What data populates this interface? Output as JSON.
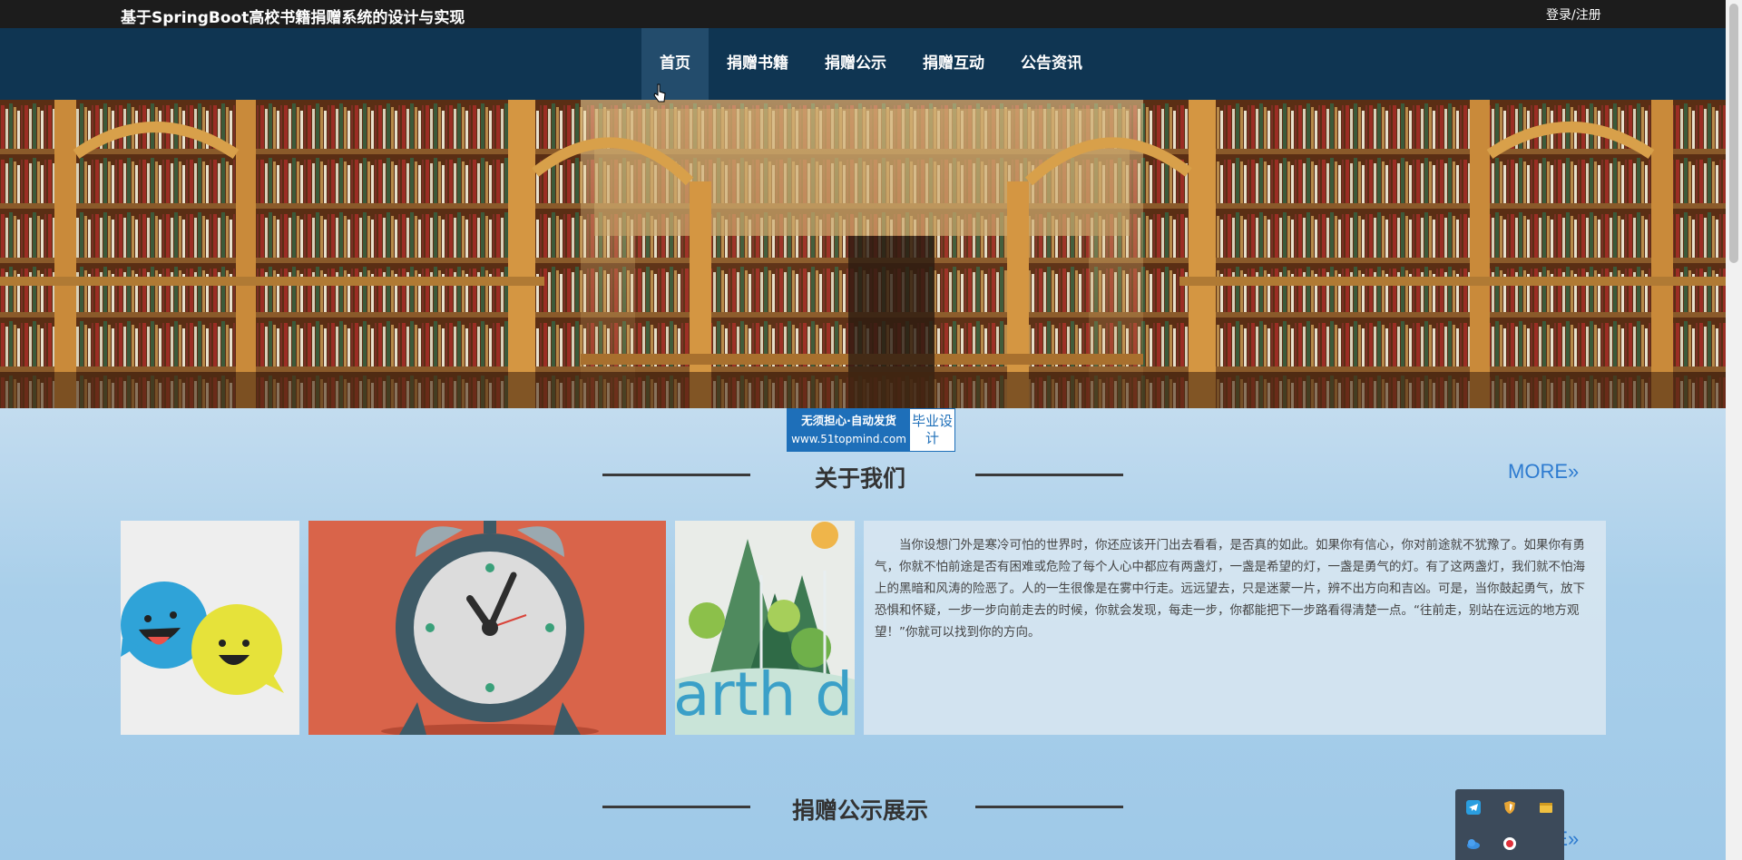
{
  "header": {
    "site_title": "基于SpringBoot高校书籍捐赠系统的设计与实现",
    "login_label": "登录/注册"
  },
  "nav": {
    "items": [
      {
        "label": "首页"
      },
      {
        "label": "捐赠书籍"
      },
      {
        "label": "捐赠公示"
      },
      {
        "label": "捐赠互动"
      },
      {
        "label": "公告资讯"
      }
    ],
    "active_index": 0
  },
  "watermark": {
    "line1": "无须担心·自动发货",
    "line2": "www.51topmind.com",
    "side": "毕业设计"
  },
  "about": {
    "title": "关于我们",
    "more_label": "MORE»",
    "text": "当你设想门外是寒冷可怕的世界时，你还应该开门出去看看，是否真的如此。如果你有信心，你对前途就不犹豫了。如果你有勇气，你就不怕前途是否有困难或危险了每个人心中都应有两盏灯，一盏是希望的灯，一盏是勇气的灯。有了这两盏灯，我们就不怕海上的黑暗和风涛的险恶了。人的一生很像是在雾中行走。远远望去，只是迷蒙一片，辨不出方向和吉凶。可是，当你鼓起勇气，放下恐惧和怀疑，一步一步向前走去的时候，你就会发现，每走一步，你都能把下一步路看得清楚一点。“往前走，别站在远远的地方观望！”你就可以找到你的方向。",
    "images": [
      {
        "name": "chat-bubbles-illustration"
      },
      {
        "name": "alarm-clock-illustration"
      },
      {
        "name": "earth-day-illustration",
        "text": "arth da"
      }
    ]
  },
  "donation": {
    "title": "捐赠公示展示",
    "more_label": "MORE»"
  },
  "tray": {
    "icons": [
      "telegram-icon",
      "shield-icon",
      "window-icon",
      "cloud-icon",
      "record-icon"
    ]
  },
  "colors": {
    "topbar": "#1c1c1c",
    "navbar": "#0f3552",
    "nav_active": "#234c6c",
    "more_link": "#2d7bd0",
    "watermark": "#1e6fb9"
  }
}
